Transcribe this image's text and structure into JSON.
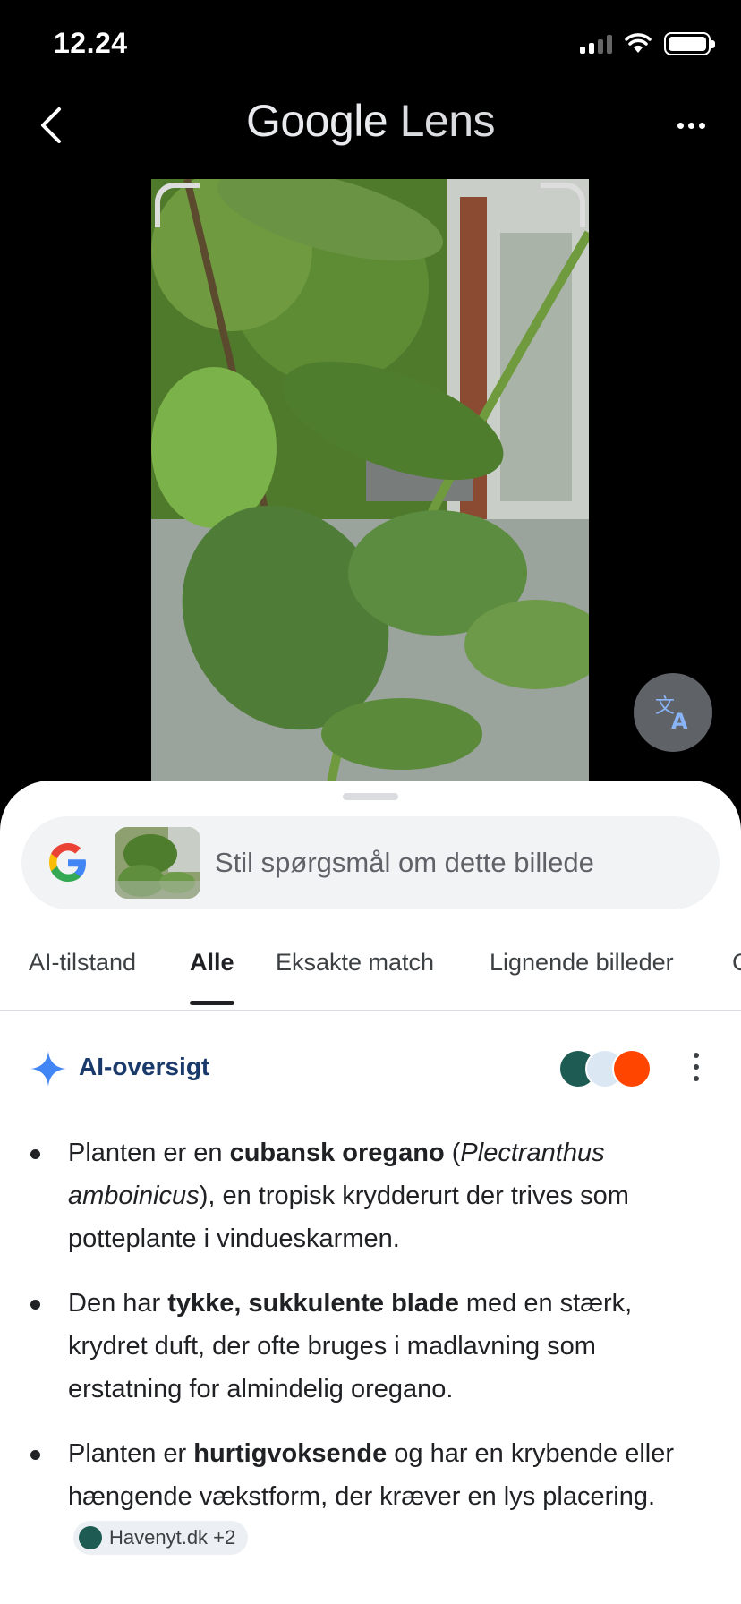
{
  "status": {
    "time": "12.24"
  },
  "header": {
    "title_google": "Google",
    "title_lens": "Lens",
    "back_icon": "chevron-left-icon",
    "more_icon": "more-horizontal-icon"
  },
  "translate_icon": "translate-icon",
  "search": {
    "placeholder": "Stil spørgsmål om dette billede"
  },
  "tabs": [
    {
      "label": "AI-tilstand",
      "active": false
    },
    {
      "label": "Alle",
      "active": true
    },
    {
      "label": "Eksakte match",
      "active": false
    },
    {
      "label": "Lignende billeder",
      "active": false
    }
  ],
  "overview": {
    "title": "AI-oversigt",
    "bullets": [
      {
        "p1": "Planten er en ",
        "b1": "cubansk oregano",
        "p2": " (",
        "i1": "Plectranthus amboinicus",
        "p3": "), en tropisk krydderurt der trives som potteplante i vindueskarmen."
      },
      {
        "p1": "Den har ",
        "b1": "tykke, sukkulente blade",
        "p2": " med en stærk, krydret duft, der ofte bruges i madlavning som erstatning for almindelig oregano."
      },
      {
        "p1": "Planten er ",
        "b1": "hurtigvoksende",
        "p2": " og har en krybende eller hængende vækstform, der kræver en lys placering.",
        "chip": "Havenyt.dk +2"
      }
    ]
  },
  "colors": {
    "accent_blue": "#4285f4",
    "title_blue": "#1a3a6b",
    "sheet_bg": "#ffffff"
  }
}
